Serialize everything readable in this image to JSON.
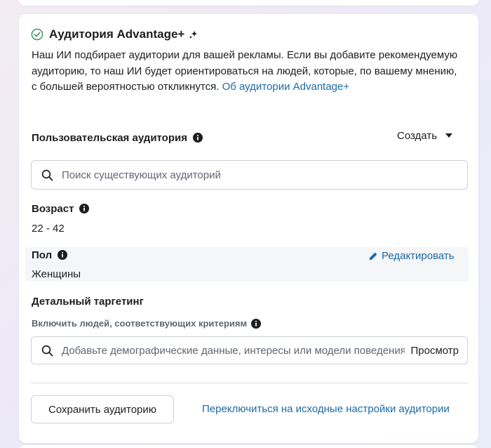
{
  "advantage": {
    "title": "Аудитория Advantage+",
    "description": "Наш ИИ подбирает аудитории для вашей рекламы. Если вы добавите рекомендуемую аудиторию, то наш ИИ будет ориентироваться на людей, которые, по вашему мнению, с большей вероятностью откликнутся.",
    "link_text": "Об аудитории Advantage+"
  },
  "custom_audience": {
    "label": "Пользовательская аудитория",
    "create_label": "Создать",
    "search_placeholder": "Поиск существующих аудиторий"
  },
  "age": {
    "label": "Возраст",
    "value": "22 - 42"
  },
  "gender": {
    "label": "Пол",
    "value": "Женщины",
    "edit_label": "Редактировать"
  },
  "detailed_targeting": {
    "label": "Детальный таргетинг",
    "criteria_label": "Включить людей, соответствующих критериям",
    "search_placeholder": "Добавьте демографические данные, интересы или модели поведения",
    "browse_label": "Просмотр"
  },
  "footer": {
    "save_label": "Сохранить аудиторию",
    "switch_label": "Переключиться на исходные настройки аудитории"
  },
  "colors": {
    "link": "#1b6aa8",
    "check": "#3a8a5c",
    "text": "#1c1e21",
    "muted": "#606770"
  }
}
